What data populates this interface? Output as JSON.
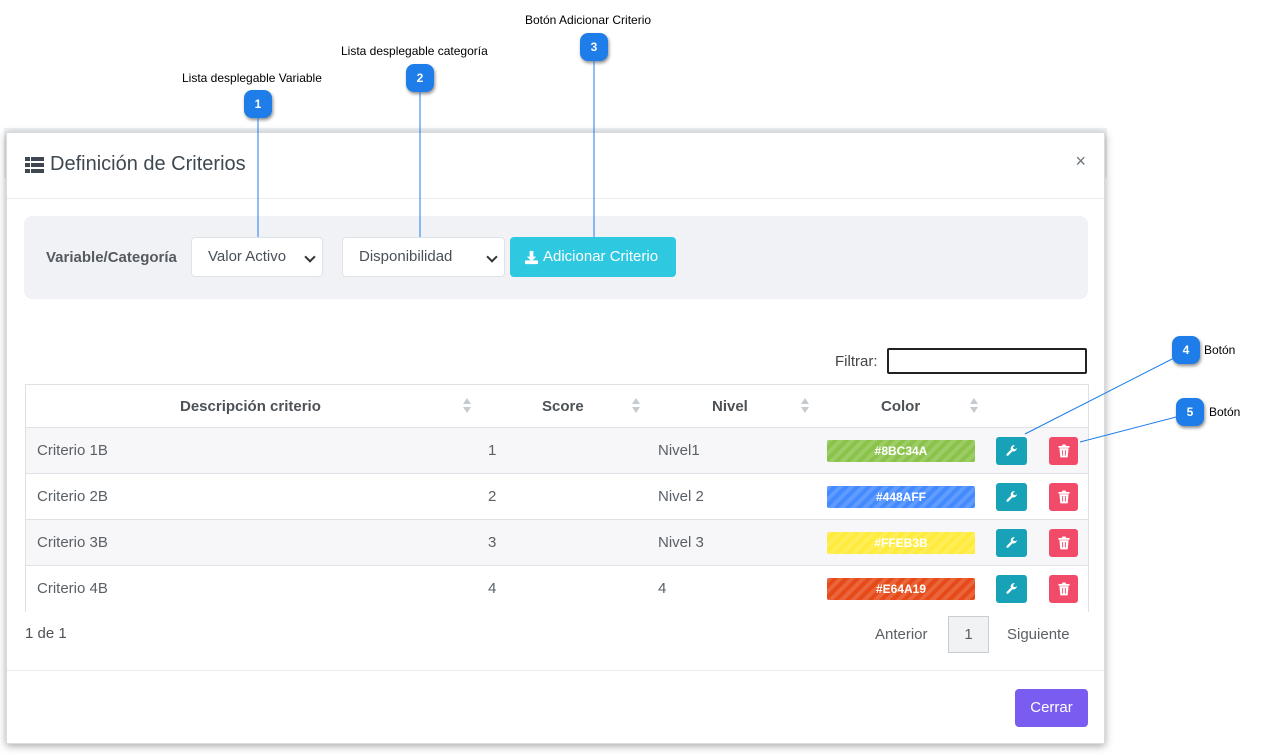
{
  "annotations": [
    {
      "number": "1",
      "label": "Lista desplegable Variable"
    },
    {
      "number": "2",
      "label": "Lista desplegable categoría"
    },
    {
      "number": "3",
      "label": "Botón Adicionar Criterio"
    },
    {
      "number": "4",
      "label": "Botón"
    },
    {
      "number": "5",
      "label": "Botón"
    }
  ],
  "modal": {
    "title": "Definición de Criterios",
    "close_symbol": "×",
    "filter_panel": {
      "label": "Variable/Categoría",
      "variable_select_value": "Valor Activo",
      "category_select_value": "Disponibilidad",
      "add_button_label": "Adicionar Criterio"
    },
    "search": {
      "label": "Filtrar:",
      "value": ""
    },
    "table": {
      "headers": [
        "Descripción criterio",
        "Score",
        "Nivel",
        "Color"
      ],
      "rows": [
        {
          "description": "Criterio 1B",
          "score": "1",
          "level": "Nivel1",
          "color": "#8BC34A"
        },
        {
          "description": "Criterio 2B",
          "score": "2",
          "level": "Nivel 2",
          "color": "#448AFF"
        },
        {
          "description": "Criterio 3B",
          "score": "3",
          "level": "Nivel 3",
          "color": "#FFEB3B"
        },
        {
          "description": "Criterio 4B",
          "score": "4",
          "level": "4",
          "color": "#E64A19"
        }
      ]
    },
    "pagination": {
      "info": "1 de 1",
      "prev": "Anterior",
      "current": "1",
      "next": "Siguiente"
    },
    "footer": {
      "close_button_label": "Cerrar"
    }
  },
  "colors": {
    "marker": "#1e7de8",
    "add_button": "#2ec8e0",
    "edit_button": "#17a2b8",
    "delete_button": "#f24b6a",
    "close_button": "#7a5cf0"
  },
  "icons": {
    "title": "list-icon",
    "add": "download-icon",
    "edit": "wrench-icon",
    "delete": "trash-icon",
    "close": "close-icon",
    "sort": "sort-icon"
  }
}
